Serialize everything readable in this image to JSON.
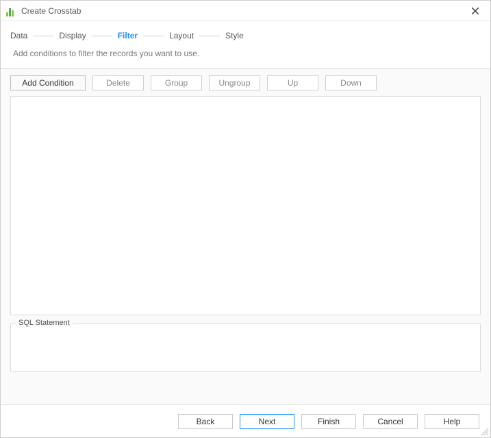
{
  "window": {
    "title": "Create Crosstab"
  },
  "steps": {
    "items": [
      {
        "label": "Data"
      },
      {
        "label": "Display"
      },
      {
        "label": "Filter"
      },
      {
        "label": "Layout"
      },
      {
        "label": "Style"
      }
    ],
    "active_index": 2
  },
  "subheader": "Add conditions to filter the records you want to use.",
  "toolbar": {
    "add_condition": "Add Condition",
    "delete": "Delete",
    "group": "Group",
    "ungroup": "Ungroup",
    "up": "Up",
    "down": "Down"
  },
  "sql": {
    "legend": "SQL Statement"
  },
  "footer": {
    "back": "Back",
    "next": "Next",
    "finish": "Finish",
    "cancel": "Cancel",
    "help": "Help"
  }
}
